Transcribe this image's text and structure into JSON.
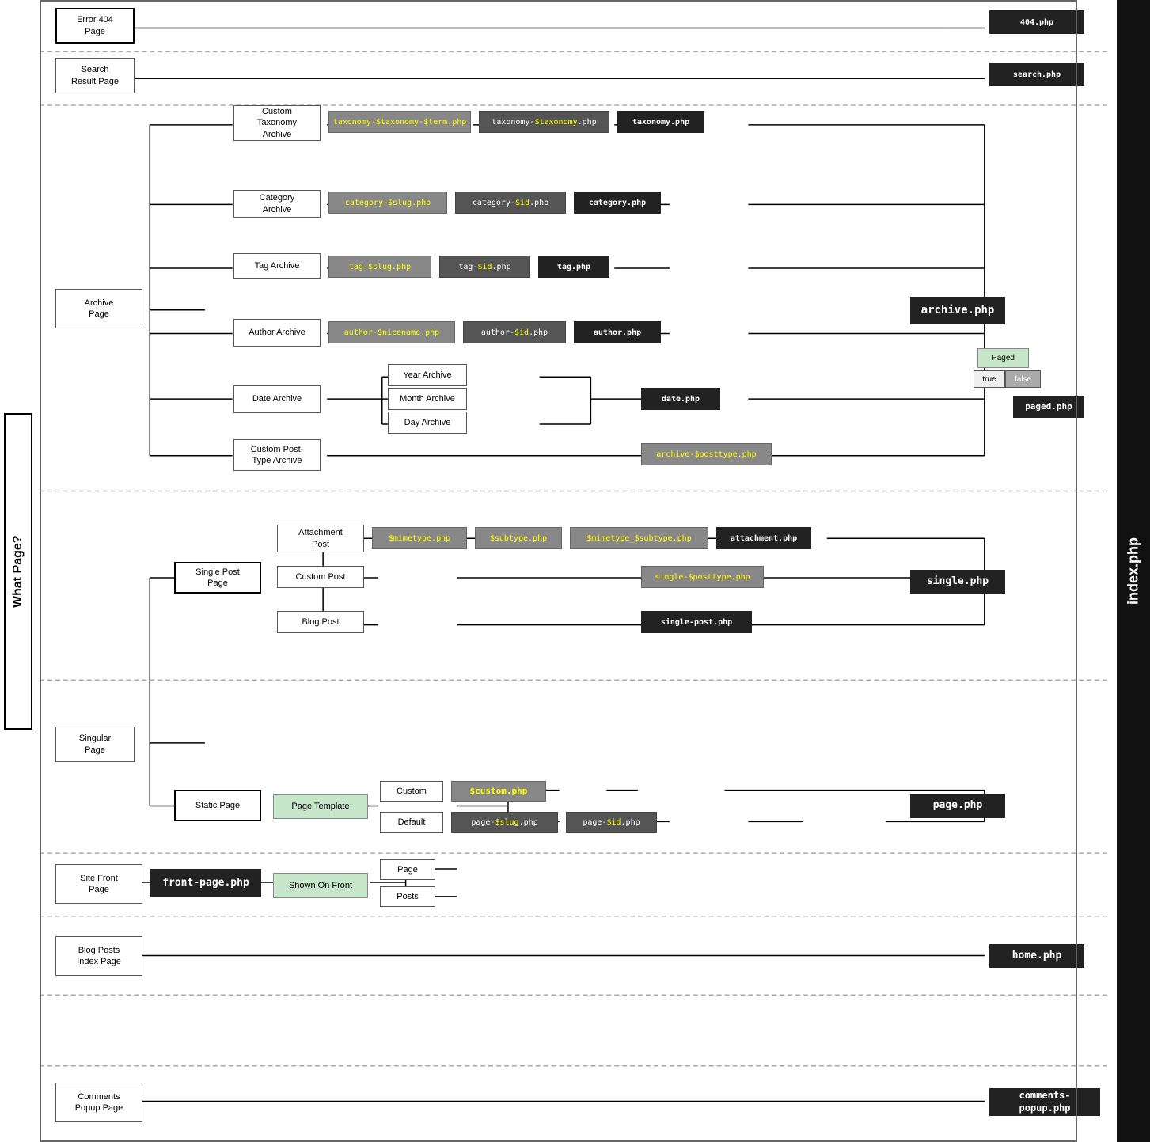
{
  "title": "What Page?",
  "index_label": "index.php",
  "sections": {
    "error404": {
      "label": "Error 404\nPage",
      "file": "404.php"
    },
    "search": {
      "label": "Search\nResult Page",
      "file": "search.php"
    },
    "archive": {
      "label": "Archive\nPage",
      "file": "archive.php",
      "sub": {
        "customTaxonomy": {
          "label": "Custom\nTaxonomy\nArchive",
          "files": [
            "taxonomy-$taxonomy-$term.php",
            "taxonomy-$taxonomy.php",
            "taxonomy.php"
          ]
        },
        "category": {
          "label": "Category\nArchive",
          "files": [
            "category-$slug.php",
            "category-$id.php",
            "category.php"
          ]
        },
        "tag": {
          "label": "Tag Archive",
          "files": [
            "tag-$slug.php",
            "tag-$id.php",
            "tag.php"
          ]
        },
        "author": {
          "label": "Author Archive",
          "files": [
            "author-$nicename.php",
            "author-$id.php",
            "author.php"
          ]
        },
        "date": {
          "label": "Date Archive",
          "sub": [
            "Year Archive",
            "Month Archive",
            "Day Archive"
          ],
          "file": "date.php"
        },
        "customPost": {
          "label": "Custom Post-\nType Archive",
          "file": "archive-$posttype.php"
        }
      },
      "paged": {
        "label": "Paged",
        "true": "true",
        "false": "false",
        "file": "paged.php"
      }
    },
    "singular": {
      "label": "Singular\nPage",
      "sub": {
        "singlePost": {
          "label": "Single Post\nPage",
          "file": "single.php",
          "sub": {
            "attachment": {
              "label": "Attachment\nPost",
              "files": [
                "$mimetype.php",
                "$subtype.php",
                "$mimetype_$subtype.php",
                "attachment.php"
              ]
            },
            "customPost": {
              "label": "Custom Post",
              "file": "single-$posttype.php"
            },
            "blogPost": {
              "label": "Blog Post",
              "file": "single-post.php"
            }
          }
        },
        "staticPage": {
          "label": "Static Page",
          "file": "page.php",
          "pageTemplate": {
            "label": "Page Template",
            "custom": {
              "label": "Custom",
              "file": "$custom.php"
            },
            "default": {
              "label": "Default",
              "files": [
                "page-$slug.php",
                "page-$id.php"
              ]
            }
          }
        }
      }
    },
    "siteFront": {
      "label": "Site Front\nPage",
      "file": "front-page.php",
      "shownOnFront": {
        "label": "Shown On Front",
        "page": "Page",
        "posts": "Posts"
      }
    },
    "blogPosts": {
      "label": "Blog Posts\nIndex Page",
      "file": "home.php"
    },
    "commentsPopup": {
      "label": "Comments\nPopup Page",
      "file": "comments-popup.php"
    }
  }
}
